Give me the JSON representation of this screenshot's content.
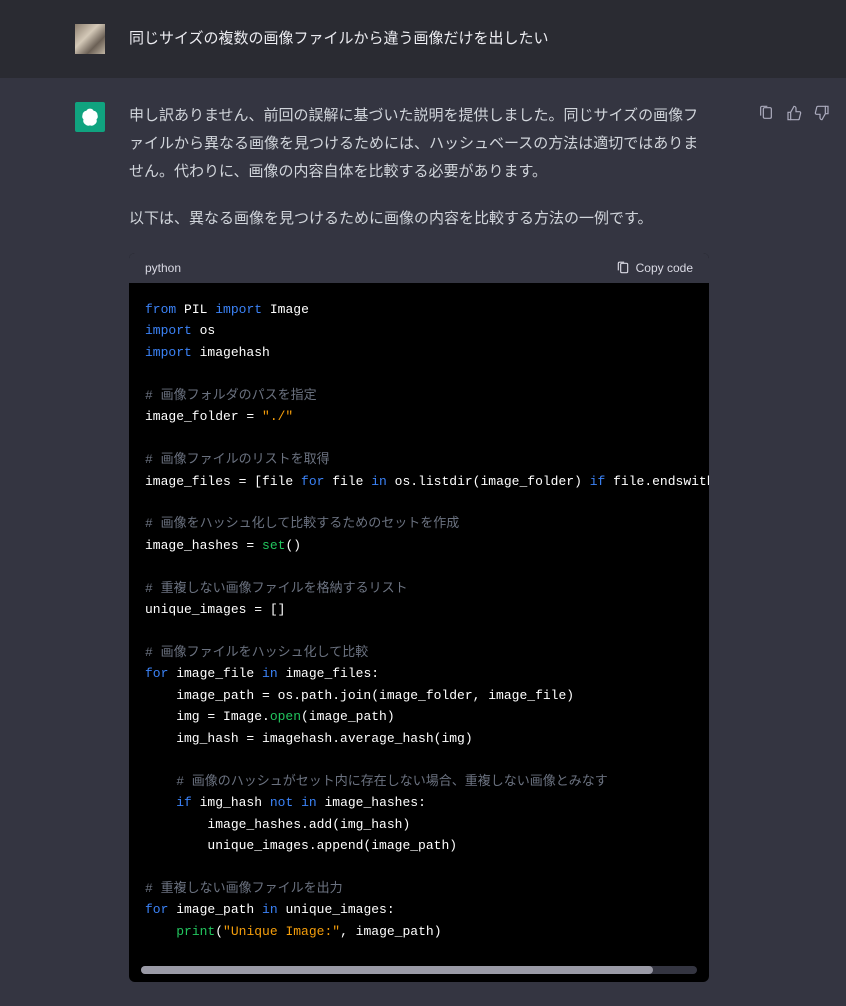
{
  "header": {
    "title": "同じサイズの複数の画像ファイルから違う画像だけを出したい"
  },
  "paragraphs": {
    "p1": "申し訳ありません、前回の誤解に基づいた説明を提供しました。同じサイズの画像ファイルから異なる画像を見つけるためには、ハッシュベースの方法は適切ではありません。代わりに、画像の内容自体を比較する必要があります。",
    "p2": "以下は、異なる画像を見つけるために画像の内容を比較する方法の一例です。"
  },
  "code": {
    "language": "python",
    "copy_label": "Copy code"
  },
  "tokens": {
    "from": "from",
    "import": "import",
    "for": "for",
    "in": "in",
    "if": "if",
    "not": "not",
    "PIL": "PIL",
    "Image": "Image",
    "os": "os",
    "imagehash": "imagehash",
    "c1": "# 画像フォルダのパスを指定",
    "l1a": "image_folder = ",
    "l1s": "\"./\"",
    "c2": "# 画像ファイルのリストを取得",
    "l2a": "image_files = [file ",
    "l2b": " file ",
    "l2c": " os.listdir(image_folder) ",
    "l2d": " file.endswith((",
    "s2": "\"",
    "c3": "# 画像をハッシュ化して比較するためのセットを作成",
    "l3a": "image_hashes = ",
    "l3b": "set",
    "l3c": "()",
    "c4": "# 重複しない画像ファイルを格納するリスト",
    "l4": "unique_images = []",
    "c5": "# 画像ファイルをハッシュ化して比較",
    "l5a": " image_file ",
    "l5b": " image_files:",
    "l6": "    image_path = os.path.join(image_folder, image_file)",
    "l7a": "    img = Image.",
    "l7b": "open",
    "l7c": "(image_path)",
    "l8": "    img_hash = imagehash.average_hash(img)",
    "c6": "    # 画像のハッシュがセット内に存在しない場合、重複しない画像とみなす",
    "l9a": "    ",
    "l9b": " img_hash ",
    "l9c": " image_hashes:",
    "l10": "        image_hashes.add(img_hash)",
    "l11": "        unique_images.append(image_path)",
    "c7": "# 重複しない画像ファイルを出力",
    "l12a": " image_path ",
    "l12b": " unique_images:",
    "l13a": "    ",
    "l13b": "print",
    "l13c": "(",
    "l13s": "\"Unique Image:\"",
    "l13d": ", image_path)"
  }
}
